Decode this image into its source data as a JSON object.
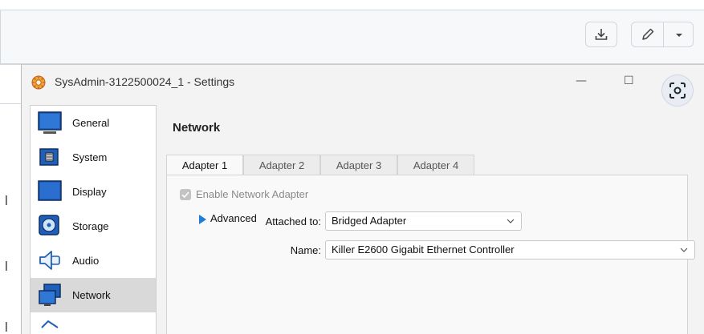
{
  "browser": {
    "download_icon": "download-icon",
    "edit_icon": "pencil-icon",
    "more_icon": "chevron-down-icon",
    "left_chars": [
      "l",
      "l",
      "l"
    ]
  },
  "window": {
    "title": "SysAdmin-3122500024_1 - Settings",
    "min_glyph": "—",
    "max_glyph": "☐",
    "lens_icon": "google-lens-icon"
  },
  "sidebar": {
    "items": [
      {
        "label": "General",
        "icon": "general-icon"
      },
      {
        "label": "System",
        "icon": "system-icon"
      },
      {
        "label": "Display",
        "icon": "display-icon"
      },
      {
        "label": "Storage",
        "icon": "storage-icon"
      },
      {
        "label": "Audio",
        "icon": "audio-icon"
      },
      {
        "label": "Network",
        "icon": "network-icon",
        "active": true
      }
    ]
  },
  "main": {
    "section_title": "Network",
    "tabs": [
      "Adapter 1",
      "Adapter 2",
      "Adapter 3",
      "Adapter 4"
    ],
    "active_tab": "Adapter 1",
    "enable_label": "Enable Network Adapter",
    "attached_label": "Attached to:",
    "attached_value": "Bridged Adapter",
    "name_label": "Name:",
    "name_value": "Killer E2600 Gigabit Ethernet Controller",
    "advanced_label": "Advanced"
  },
  "colors": {
    "accent": "#1e7fd6",
    "active_sidebar": "#d9d9d9"
  }
}
